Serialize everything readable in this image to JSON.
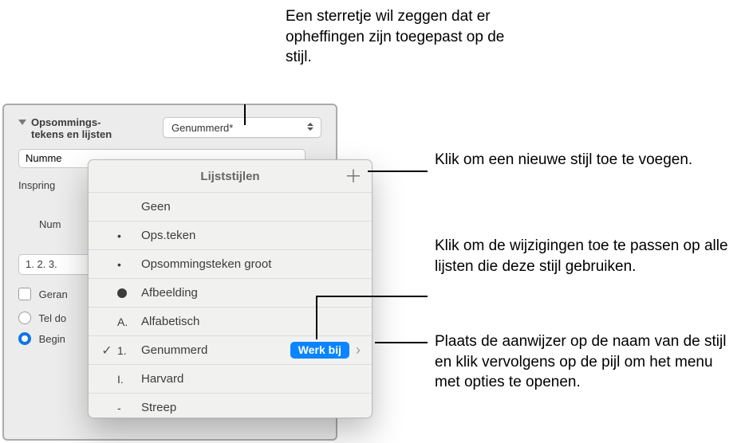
{
  "panel": {
    "section_title": "Opsommings-\ntekens en lijsten",
    "style_select": "Genummerd*",
    "number_prefix": "Numme",
    "indent_label": "Inspring",
    "numbering_label": "Num",
    "format_sample": "1. 2. 3.",
    "tier_label": "Geran",
    "count_label": "Tel do",
    "start_label": "Begin"
  },
  "popup": {
    "title": "Lijststijlen",
    "styles": [
      {
        "bullet": "",
        "label": "Geen",
        "checked": false
      },
      {
        "bullet": "•",
        "label": "Ops.teken",
        "checked": false
      },
      {
        "bullet": "•",
        "label": "Opsommingsteken groot",
        "checked": false
      },
      {
        "bullet": "img",
        "label": "Afbeelding",
        "checked": false
      },
      {
        "bullet": "A.",
        "label": "Alfabetisch",
        "checked": false
      },
      {
        "bullet": "1.",
        "label": "Genummerd",
        "checked": true
      },
      {
        "bullet": "I.",
        "label": "Harvard",
        "checked": false
      },
      {
        "bullet": "-",
        "label": "Streep",
        "checked": false
      }
    ],
    "update_label": "Werk bij"
  },
  "callouts": {
    "asterisk": "Een sterretje wil zeggen dat er opheffingen zijn toegepast op de stijl.",
    "add": "Klik om een nieuwe stijl toe te voegen.",
    "apply": "Klik om de wijzigingen toe te passen op alle lijsten die deze stijl gebruiken.",
    "arrow": "Plaats de aanwijzer op de naam van de stijl en klik vervolgens op de pijl om het menu met opties te openen."
  }
}
